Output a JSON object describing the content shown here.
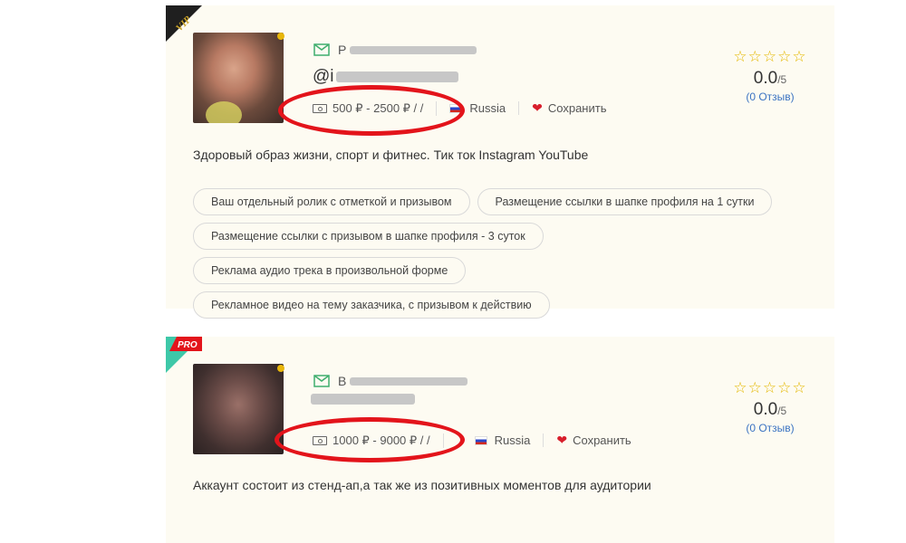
{
  "cards": [
    {
      "badge": "VIP",
      "name_prefix": "P",
      "handle_prefix": "@i",
      "price": "500 ₽ - 2500 ₽ / /",
      "country": "Russia",
      "save_label": "Сохранить",
      "stars": "☆☆☆☆☆",
      "score": "0.0",
      "score_max": "/5",
      "reviews": "(0 Отзыв)",
      "description": "Здоровый образ жизни, спорт и фитнес. Тик ток Instagram YouTube",
      "tags": [
        "Ваш отдельный ролик с отметкой и призывом",
        "Размещение ссылки в шапке профиля на 1 сутки",
        "Размещение ссылки с призывом в шапке профиля - 3 суток",
        "Реклама аудио трека в произвольной форме",
        "Рекламное видео на тему заказчика, с призывом к действию"
      ]
    },
    {
      "badge": "PRO",
      "name_prefix": "B",
      "handle_prefix": "",
      "price": "1000 ₽ - 9000 ₽ / /",
      "country": "Russia",
      "save_label": "Сохранить",
      "stars": "☆☆☆☆☆",
      "score": "0.0",
      "score_max": "/5",
      "reviews": "(0 Отзыв)",
      "description": "Аккаунт состоит из стенд-ап,а так же из позитивных моментов для аудитории"
    }
  ],
  "colors": {
    "accent_red": "#e3141b",
    "star": "#e5b800",
    "link": "#3b73c2",
    "vip_badge": "#c9a227",
    "pro_badge": "#3ec8a8"
  }
}
